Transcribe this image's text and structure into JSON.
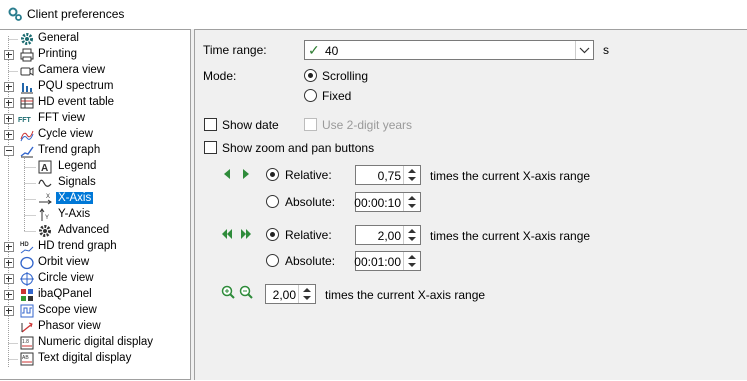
{
  "window": {
    "title": "Client preferences",
    "icon": "gears-icon"
  },
  "tree": {
    "items": [
      {
        "label": "General",
        "icon": "gear-icon"
      },
      {
        "label": "Printing",
        "icon": "printer-icon"
      },
      {
        "label": "Camera view",
        "icon": "camera-icon"
      },
      {
        "label": "PQU spectrum",
        "icon": "bar-chart-icon"
      },
      {
        "label": "HD event table",
        "icon": "table-icon"
      },
      {
        "label": "FFT view",
        "icon": "fft-icon"
      },
      {
        "label": "Cycle view",
        "icon": "cycle-icon"
      },
      {
        "label": "Trend graph",
        "icon": "trend-icon"
      },
      {
        "label": "Legend",
        "icon": "legend-icon"
      },
      {
        "label": "Signals",
        "icon": "signal-wave-icon"
      },
      {
        "label": "X-Axis",
        "icon": "x-axis-icon",
        "selected": true
      },
      {
        "label": "Y-Axis",
        "icon": "y-axis-icon"
      },
      {
        "label": "Advanced",
        "icon": "gear-icon"
      },
      {
        "label": "HD trend graph",
        "icon": "hd-trend-icon"
      },
      {
        "label": "Orbit view",
        "icon": "orbit-icon"
      },
      {
        "label": "Circle view",
        "icon": "circle-view-icon"
      },
      {
        "label": "ibaQPanel",
        "icon": "qpanel-icon"
      },
      {
        "label": "Scope view",
        "icon": "scope-icon"
      },
      {
        "label": "Phasor view",
        "icon": "phasor-icon"
      },
      {
        "label": "Numeric digital display",
        "icon": "numeric-display-icon"
      },
      {
        "label": "Text digital display",
        "icon": "text-display-icon"
      }
    ]
  },
  "panel": {
    "time_range_label": "Time range:",
    "time_range_value": "40",
    "time_range_unit": "s",
    "mode_label": "Mode:",
    "mode_scrolling": "Scrolling",
    "mode_fixed": "Fixed",
    "mode_selected": "Scrolling",
    "show_date": "Show date",
    "show_date_checked": false,
    "use_2digit": "Use 2-digit years",
    "show_zoom": "Show zoom and pan buttons",
    "show_zoom_checked": false,
    "step": {
      "relative_label": "Relative:",
      "relative_value": "0,75",
      "relative_suffix": "times the current X-axis range",
      "absolute_label": "Absolute:",
      "absolute_value": "00:00:10",
      "selected": "Relative"
    },
    "page": {
      "relative_label": "Relative:",
      "relative_value": "2,00",
      "relative_suffix": "times the current X-axis range",
      "absolute_label": "Absolute:",
      "absolute_value": "00:01:00",
      "selected": "Relative"
    },
    "zoom": {
      "value": "2,00",
      "suffix": "times the current X-axis range"
    }
  },
  "colors": {
    "accent": "#0078d7",
    "arrow_green": "#2e8b3a"
  }
}
